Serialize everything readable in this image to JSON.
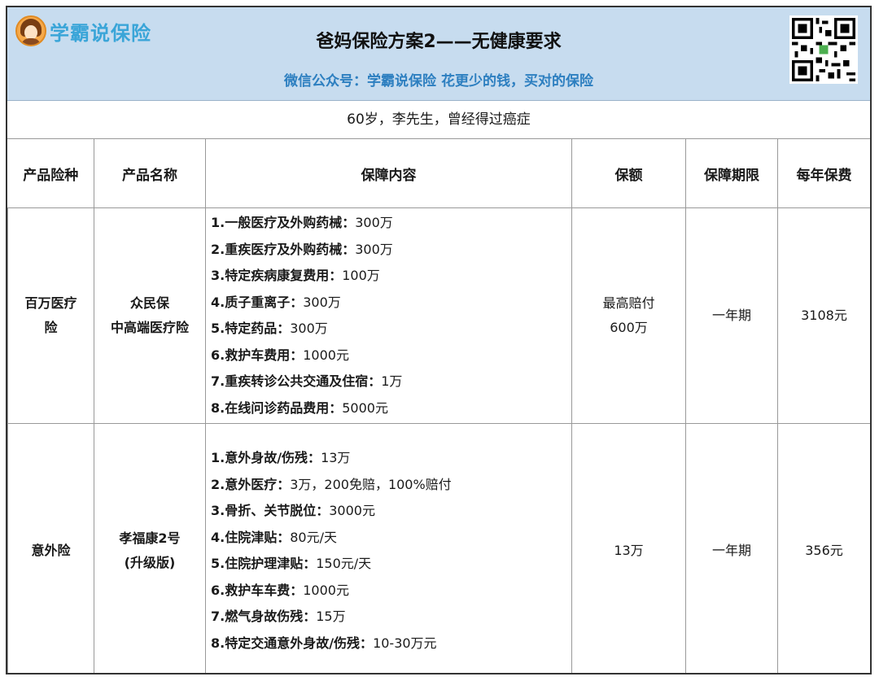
{
  "header": {
    "logo_text": "学霸说保险",
    "title": "爸妈保险方案2——无健康要求",
    "subtitle": "微信公众号：学霸说保险    花更少的钱，买对的保险"
  },
  "intro": "60岁，李先生，曾经得过癌症",
  "columns": [
    "产品险种",
    "产品名称",
    "保障内容",
    "保额",
    "保障期限",
    "每年保费"
  ],
  "rows": [
    {
      "type_line1": "百万医疗",
      "type_line2": "险",
      "name_line1": "众民保",
      "name_line2": "中高端医疗险",
      "items": [
        {
          "label": "1.一般医疗及外购药械：",
          "value": "300万"
        },
        {
          "label": "2.重疾医疗及外购药械：",
          "value": "300万"
        },
        {
          "label": "3.特定疾病康复费用：",
          "value": "100万"
        },
        {
          "label": "4.质子重离子：",
          "value": "300万"
        },
        {
          "label": "5.特定药品：",
          "value": "300万"
        },
        {
          "label": "6.救护车费用：",
          "value": "1000元"
        },
        {
          "label": "7.重疾转诊公共交通及住宿：",
          "value": "1万"
        },
        {
          "label": "8.在线问诊药品费用：",
          "value": "5000元"
        }
      ],
      "amount_line1": "最高赔付",
      "amount_line2": "600万",
      "term": "一年期",
      "premium": "3108元"
    },
    {
      "type_line1": "意外险",
      "type_line2": "",
      "name_line1": "孝福康2号",
      "name_line2": "(升级版)",
      "items": [
        {
          "label": "1.意外身故/伤残：",
          "value": "13万"
        },
        {
          "label": "2.意外医疗：",
          "value": "3万，200免赔，100%赔付"
        },
        {
          "label": "3.骨折、关节脱位：",
          "value": "3000元"
        },
        {
          "label": "4.住院津贴：",
          "value": "80元/天"
        },
        {
          "label": "5.住院护理津贴：",
          "value": "150元/天"
        },
        {
          "label": "6.救护车车费：",
          "value": "1000元"
        },
        {
          "label": "7.燃气身故伤残：",
          "value": "15万"
        },
        {
          "label": "8.特定交通意外身故/伤残：",
          "value": "10-30万元"
        }
      ],
      "amount_line1": "13万",
      "amount_line2": "",
      "term": "一年期",
      "premium": "356元"
    }
  ]
}
